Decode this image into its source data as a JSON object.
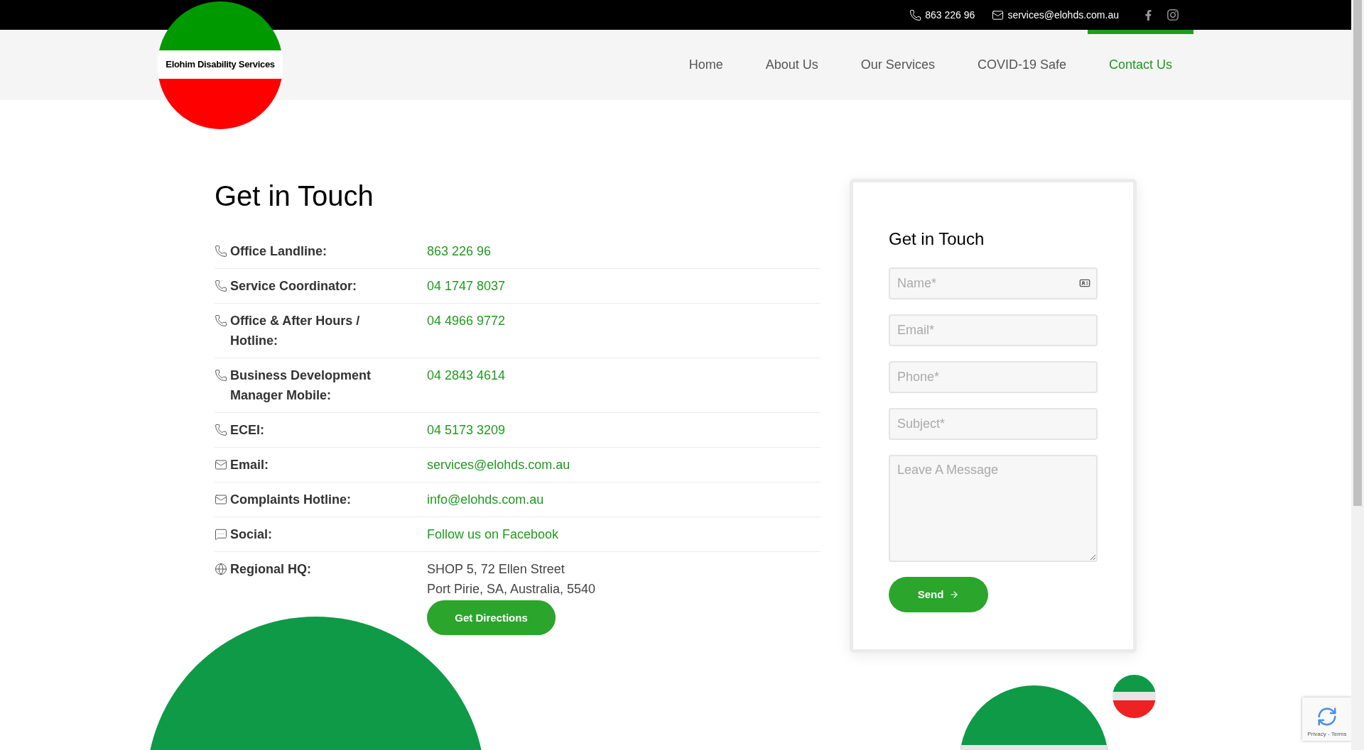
{
  "top_bar": {
    "phone": "863 226 96",
    "email": "services@elohds.com.au"
  },
  "logo": {
    "text": "Elohim Disability Services"
  },
  "nav": [
    {
      "label": "Home",
      "selected": false
    },
    {
      "label": "About Us",
      "selected": false
    },
    {
      "label": "Our Services",
      "selected": false
    },
    {
      "label": "COVID-19 Safe",
      "selected": false
    },
    {
      "label": "Contact Us",
      "selected": true
    }
  ],
  "contact": {
    "title": "Get in Touch",
    "rows": [
      {
        "kind": "phone",
        "label": "Office Landline:",
        "values": [
          "863 226 96"
        ]
      },
      {
        "kind": "phone",
        "label": "Service Coordinator:",
        "values": [
          "04 1747 8037"
        ]
      },
      {
        "kind": "phone",
        "label": "Office & After Hours / Hotline:",
        "values": [
          "04 4966 9772"
        ]
      },
      {
        "kind": "phone",
        "label": "Business Development Manager Mobile:",
        "values": [
          "04 2843 4614"
        ]
      },
      {
        "kind": "phone",
        "label": "ECEI:",
        "values": [
          "04 5173 3209"
        ]
      },
      {
        "kind": "email",
        "label": "Email:",
        "values": [
          "services@elohds.com.au"
        ]
      },
      {
        "kind": "email",
        "label": "Complaints Hotline:",
        "values": [
          "info@elohds.com.au"
        ]
      },
      {
        "kind": "social",
        "label": "Social:",
        "values": [
          "Follow us on Facebook"
        ]
      },
      {
        "kind": "address",
        "label": "Regional HQ:",
        "values": [
          "SHOP 5, 72 Ellen Street",
          "Port Pirie, SA, Australia, 5540"
        ],
        "button": "Get Directions"
      }
    ]
  },
  "form": {
    "title": "Get in Touch",
    "fields": [
      {
        "kind": "input",
        "placeholder": "Name*",
        "has_icon": true
      },
      {
        "kind": "input",
        "placeholder": "Email*",
        "has_icon": false
      },
      {
        "kind": "input",
        "placeholder": "Phone*",
        "has_icon": false
      },
      {
        "kind": "input",
        "placeholder": "Subject*",
        "has_icon": false
      },
      {
        "kind": "textarea",
        "placeholder": "Leave A Message"
      }
    ],
    "submit": "Send"
  },
  "recaptcha": {
    "text": "Privacy - Terms"
  }
}
